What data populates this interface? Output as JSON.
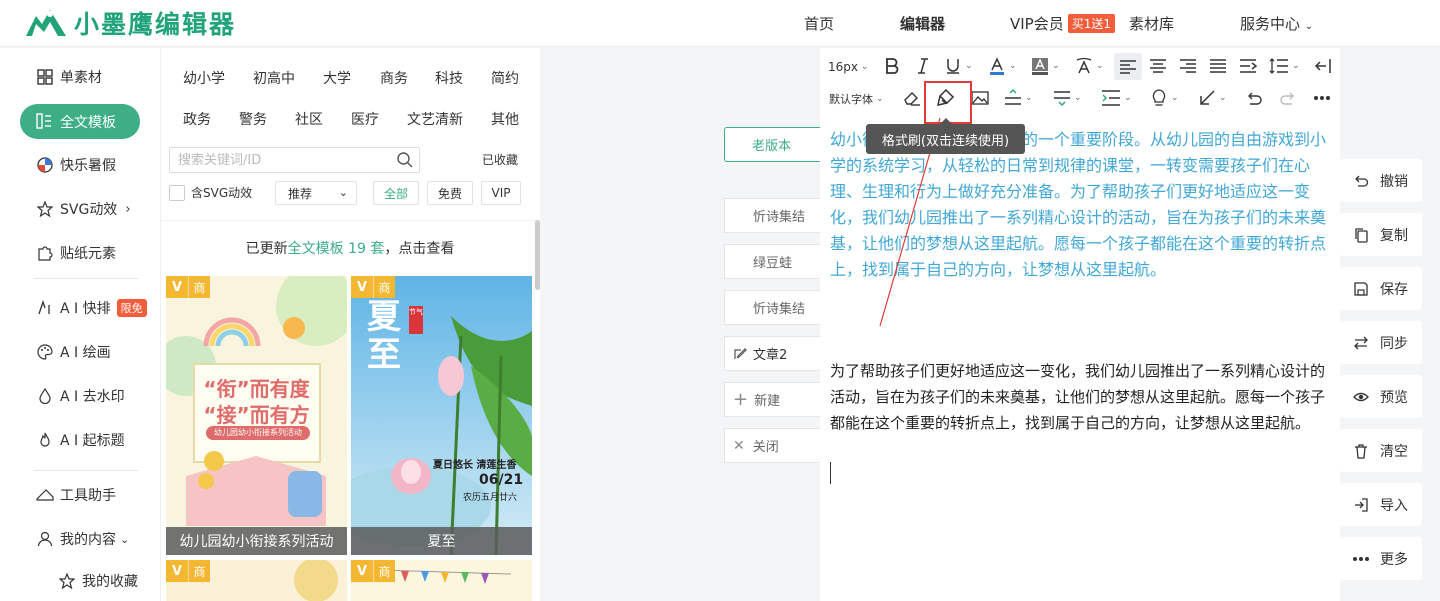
{
  "header": {
    "logo_text": "小墨鹰编辑器",
    "nav": {
      "home": "首页",
      "editor": "编辑器",
      "vip": "VIP会员",
      "vip_badge": "买1送1",
      "materials": "素材库",
      "service": "服务中心"
    }
  },
  "sidebar": {
    "items": {
      "single_material": "单素材",
      "full_template": "全文模板",
      "summer": "快乐暑假",
      "svg": "SVG动效",
      "stickers": "贴纸元素",
      "ai_layout": "A I 快排",
      "ai_layout_badge": "限免",
      "ai_draw": "A I 绘画",
      "ai_watermark": "A I 去水印",
      "ai_title": "A I 起标题",
      "tools": "工具助手",
      "my_content": "我的内容",
      "my_fav": "我的收藏"
    }
  },
  "panel": {
    "categories_row1": [
      "幼小学",
      "初高中",
      "大学",
      "商务",
      "科技",
      "简约"
    ],
    "categories_row2": [
      "政务",
      "警务",
      "社区",
      "医疗",
      "文艺清新",
      "其他"
    ],
    "search_placeholder": "搜索关键词/ID",
    "collected": "已收藏",
    "svg_checkbox": "含SVG动效",
    "sort_select": "推荐",
    "filters": [
      "全部",
      "免费",
      "VIP"
    ],
    "updated_prefix": "已更新",
    "updated_highlight": "全文模板 19 套",
    "updated_suffix": "，点击查看",
    "cards": [
      {
        "label": "幼儿园幼小衔接系列活动",
        "poster_line1": "“衔”而有度",
        "poster_line2": "“接”而有方",
        "poster_sub": "幼儿园幼小衔接系列活动",
        "corner_v": "V",
        "corner_s": "商"
      },
      {
        "label": "夏至",
        "poster_title_1": "夏",
        "poster_title_2": "至",
        "poster_tag": "节气",
        "poster_slogan": "夏日悠长 清莲生香",
        "poster_date": "06/21",
        "poster_lunar": "农历五月廿六",
        "corner_v": "V",
        "corner_s": "商"
      },
      {
        "corner_v": "V",
        "corner_s": "商"
      },
      {
        "corner_v": "V",
        "corner_s": "商"
      }
    ]
  },
  "docs": {
    "old_version": "老版本",
    "items": [
      "忻诗集结",
      "绿豆蛙",
      "忻诗集结",
      "文章2"
    ],
    "new": "新建",
    "close": "关闭"
  },
  "editor": {
    "font_size": "16px",
    "font_family": "默认字体",
    "tooltip": "格式刷(双击连续使用)",
    "para1": "幼小衔接是孩子成长旅程中的一个重要阶段。从幼儿园的自由游戏到小学的系统学习，从轻松的日常到规律的课堂，一转变需要孩子们在心理、生理和行为上做好充分准备。为了帮助孩子们更好地适应这一变化，我们幼儿园推出了一系列精心设计的活动，旨在为孩子们的未来奠基，让他们的梦想从这里起航。愿每一个孩子都能在这个重要的转折点上，找到属于自己的方向，让梦想从这里起航。",
    "para2": "为了帮助孩子们更好地适应这一变化，我们幼儿园推出了一系列精心设计的活动，旨在为孩子们的未来奠基，让他们的梦想从这里起航。愿每一个孩子都能在这个重要的转折点上，找到属于自己的方向，让梦想从这里起航。",
    "colors": {
      "para1": "#41a7d6",
      "accent": "#3dae86",
      "annotation": "#e03a3a"
    }
  },
  "actions": {
    "undo": "撤销",
    "copy": "复制",
    "save": "保存",
    "sync": "同步",
    "preview": "预览",
    "clear": "清空",
    "import": "导入",
    "more": "更多"
  }
}
